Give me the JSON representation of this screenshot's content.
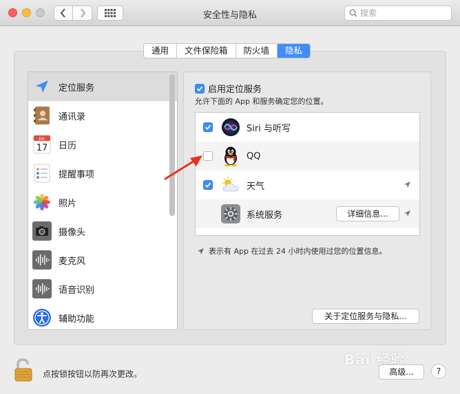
{
  "window": {
    "title": "安全性与隐私"
  },
  "search": {
    "placeholder": "搜索"
  },
  "tabs": [
    {
      "label": "通用",
      "active": false
    },
    {
      "label": "文件保险箱",
      "active": false
    },
    {
      "label": "防火墙",
      "active": false
    },
    {
      "label": "隐私",
      "active": true
    }
  ],
  "sidebar": {
    "items": [
      {
        "label": "定位服务",
        "icon": "location-arrow-icon",
        "selected": true
      },
      {
        "label": "通讯录",
        "icon": "contacts-icon",
        "selected": false
      },
      {
        "label": "日历",
        "icon": "calendar-icon",
        "selected": false
      },
      {
        "label": "提醒事项",
        "icon": "reminders-icon",
        "selected": false
      },
      {
        "label": "照片",
        "icon": "photos-icon",
        "selected": false
      },
      {
        "label": "摄像头",
        "icon": "camera-icon",
        "selected": false
      },
      {
        "label": "麦克风",
        "icon": "microphone-icon",
        "selected": false
      },
      {
        "label": "语音识别",
        "icon": "speech-recognition-icon",
        "selected": false
      },
      {
        "label": "辅助功能",
        "icon": "accessibility-icon",
        "selected": false
      }
    ]
  },
  "calendar_icon": {
    "month": "JUL",
    "day": "17"
  },
  "location": {
    "enable_label": "启用定位服务",
    "enabled": true,
    "description": "允许下面的 App 和服务确定您的位置。",
    "apps": [
      {
        "name": "Siri 与听写",
        "checked": true,
        "icon": "siri-icon",
        "recent": false
      },
      {
        "name": "QQ",
        "checked": false,
        "icon": "qq-penguin-icon",
        "recent": false
      },
      {
        "name": "天气",
        "checked": true,
        "icon": "weather-icon",
        "recent": true
      },
      {
        "name": "系统服务",
        "checked": null,
        "icon": "system-services-icon",
        "recent": true,
        "details_label": "详细信息..."
      }
    ],
    "legend": "表示有 App 在过去 24 小时内使用过您的位置信息。",
    "about_label": "关于定位服务与隐私..."
  },
  "footer": {
    "lock_text": "点按锁按钮以防再次更改。",
    "advanced_label": "高级...",
    "help_label": "?"
  },
  "watermark": "Bai 经验",
  "colors": {
    "accent": "#3e8ef5",
    "arrow": "#e8321f"
  }
}
